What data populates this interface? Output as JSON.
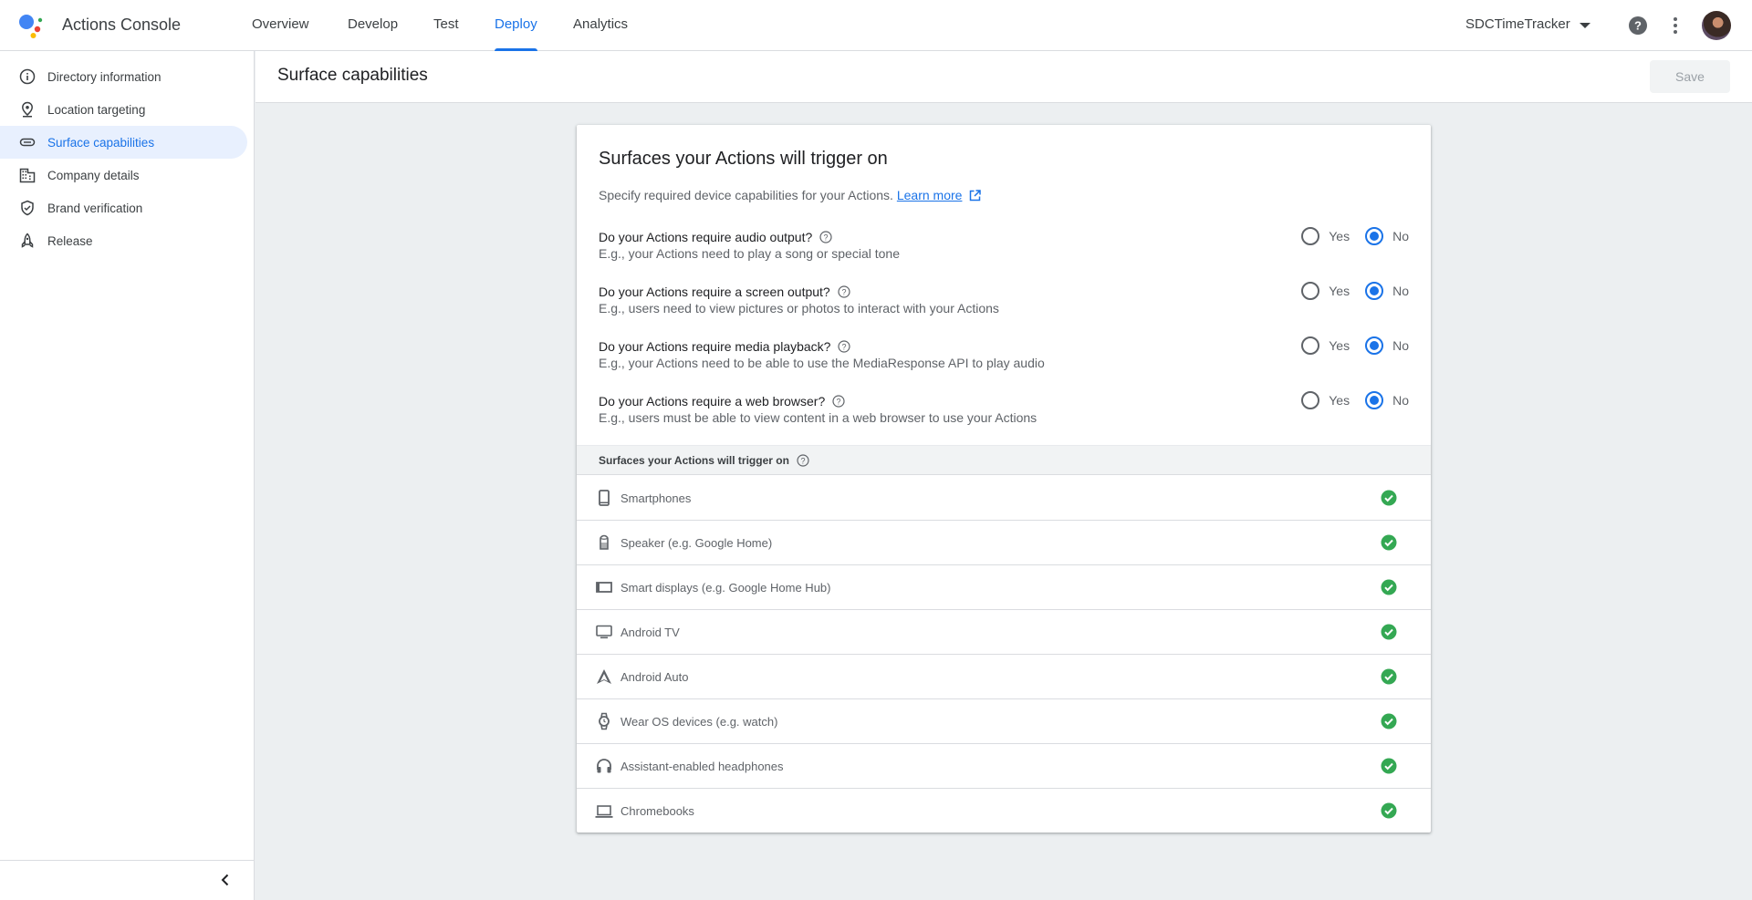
{
  "app": {
    "title": "Actions Console"
  },
  "nav": {
    "tabs": [
      {
        "label": "Overview"
      },
      {
        "label": "Develop"
      },
      {
        "label": "Test"
      },
      {
        "label": "Deploy",
        "active": true
      },
      {
        "label": "Analytics"
      }
    ]
  },
  "project": {
    "name": "SDCTimeTracker"
  },
  "sidebar": {
    "items": [
      {
        "label": "Directory information",
        "icon": "info-icon"
      },
      {
        "label": "Location targeting",
        "icon": "location-pin-icon"
      },
      {
        "label": "Surface capabilities",
        "icon": "surface-icon",
        "active": true
      },
      {
        "label": "Company details",
        "icon": "building-icon"
      },
      {
        "label": "Brand verification",
        "icon": "verified-shield-icon"
      },
      {
        "label": "Release",
        "icon": "rocket-icon"
      }
    ]
  },
  "header": {
    "title": "Surface capabilities",
    "save_label": "Save"
  },
  "card": {
    "title": "Surfaces your Actions will trigger on",
    "description": "Specify required device capabilities for your Actions.",
    "learn_more": "Learn more",
    "yes_label": "Yes",
    "no_label": "No",
    "questions": [
      {
        "question": "Do your Actions require audio output?",
        "example": "E.g., your Actions need to play a song or special tone",
        "selected": "No"
      },
      {
        "question": "Do your Actions require a screen output?",
        "example": "E.g., users need to view pictures or photos to interact with your Actions",
        "selected": "No"
      },
      {
        "question": "Do your Actions require media playback?",
        "example": "E.g., your Actions need to be able to use the MediaResponse API to play audio",
        "selected": "No"
      },
      {
        "question": "Do your Actions require a web browser?",
        "example": "E.g., users must be able to view content in a web browser to use your Actions",
        "selected": "No"
      }
    ],
    "surfaces_header": "Surfaces your Actions will trigger on",
    "surfaces": [
      {
        "label": "Smartphones",
        "icon": "smartphone-icon"
      },
      {
        "label": "Speaker (e.g. Google Home)",
        "icon": "speaker-icon"
      },
      {
        "label": "Smart displays (e.g. Google Home Hub)",
        "icon": "smart-display-icon"
      },
      {
        "label": "Android TV",
        "icon": "tv-icon"
      },
      {
        "label": "Android Auto",
        "icon": "android-auto-icon"
      },
      {
        "label": "Wear OS devices (e.g. watch)",
        "icon": "watch-icon"
      },
      {
        "label": "Assistant-enabled headphones",
        "icon": "headphones-icon"
      },
      {
        "label": "Chromebooks",
        "icon": "laptop-icon"
      }
    ]
  },
  "colors": {
    "accent": "#1a73e8",
    "check": "#34a853"
  }
}
